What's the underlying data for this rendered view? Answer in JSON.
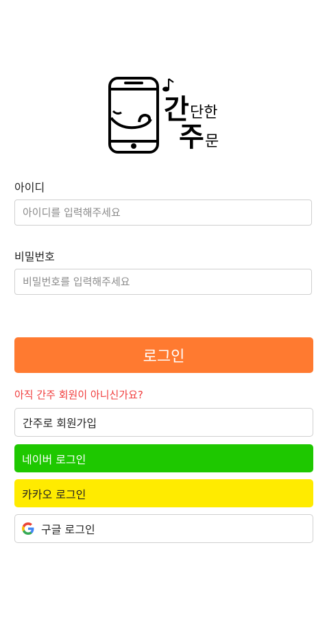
{
  "logo": {
    "char_gan": "간",
    "char_dan_han": "단한",
    "char_ju": "주",
    "char_mun": "문"
  },
  "login_form": {
    "id_label": "아이디",
    "id_placeholder": "아이디를 입력해주세요",
    "pw_label": "비밀번호",
    "pw_placeholder": "비밀번호를 입력해주세요",
    "login_button": "로그인"
  },
  "signup": {
    "prompt": "아직 간주 회원이 아니신가요?",
    "own_signup": "간주로 회원가입",
    "naver": "네이버 로그인",
    "kakao": "카카오 로그인",
    "google": "구글 로그인"
  },
  "colors": {
    "accent": "#ff7a30",
    "prompt": "#f03c3c",
    "naver": "#1ec800",
    "kakao": "#ffeb00"
  },
  "icons": {
    "logo": "phone-smile-logo",
    "google": "google-g-icon"
  }
}
